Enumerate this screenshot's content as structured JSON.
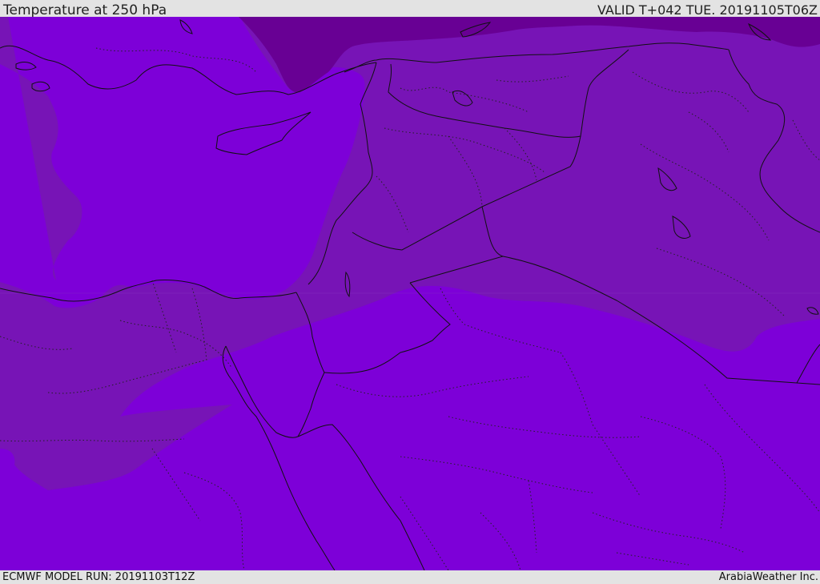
{
  "header": {
    "title": "Temperature at 250 hPa",
    "valid_time": "VALID T+042 TUE. 20191105T06Z"
  },
  "footer": {
    "model_run": "ECMWF MODEL RUN: 20191103T12Z",
    "credit": "ArabiaWeather Inc."
  },
  "map": {
    "fill_colors": {
      "warmest_band": "#7d00d8",
      "middle_band": "#7714b6",
      "coldest_band": "#680094"
    },
    "border_color": "#111111"
  }
}
